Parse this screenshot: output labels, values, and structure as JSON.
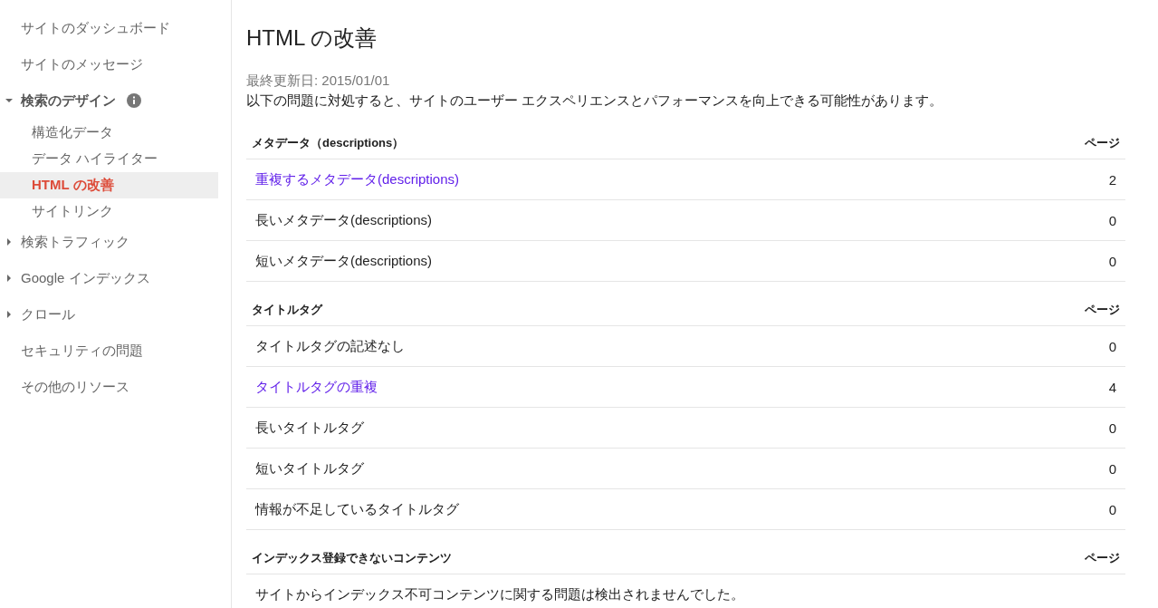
{
  "sidebar": {
    "items": [
      {
        "label": "サイトのダッシュボード",
        "kind": "link",
        "selected": false
      },
      {
        "label": "サイトのメッセージ",
        "kind": "link",
        "selected": false
      },
      {
        "label": "検索のデザイン",
        "kind": "group",
        "expanded": true,
        "info_icon": true,
        "selected": false,
        "children": [
          {
            "label": "構造化データ",
            "selected": false
          },
          {
            "label": "データ ハイライター",
            "selected": false
          },
          {
            "label": "HTML の改善",
            "selected": true
          },
          {
            "label": "サイトリンク",
            "selected": false
          }
        ]
      },
      {
        "label": "検索トラフィック",
        "kind": "group",
        "expanded": false,
        "selected": false
      },
      {
        "label": "Google インデックス",
        "kind": "group",
        "expanded": false,
        "selected": false
      },
      {
        "label": "クロール",
        "kind": "group",
        "expanded": false,
        "selected": false
      },
      {
        "label": "セキュリティの問題",
        "kind": "link",
        "selected": false
      },
      {
        "label": "その他のリソース",
        "kind": "link",
        "selected": false
      }
    ]
  },
  "page": {
    "title": "HTML の改善",
    "updated": "最終更新日: 2015/01/01",
    "description": "以下の問題に対処すると、サイトのユーザー エクスペリエンスとパフォーマンスを向上できる可能性があります。"
  },
  "sections": [
    {
      "title": "メタデータ（descriptions）",
      "column": "ページ",
      "rows": [
        {
          "label": "重複するメタデータ(descriptions)",
          "count": "2",
          "link": true
        },
        {
          "label": "長いメタデータ(descriptions)",
          "count": "0",
          "link": false
        },
        {
          "label": "短いメタデータ(descriptions)",
          "count": "0",
          "link": false
        }
      ]
    },
    {
      "title": "タイトルタグ",
      "column": "ページ",
      "rows": [
        {
          "label": "タイトルタグの記述なし",
          "count": "0",
          "link": false
        },
        {
          "label": "タイトルタグの重複",
          "count": "4",
          "link": true
        },
        {
          "label": "長いタイトルタグ",
          "count": "0",
          "link": false
        },
        {
          "label": "短いタイトルタグ",
          "count": "0",
          "link": false
        },
        {
          "label": "情報が不足しているタイトルタグ",
          "count": "0",
          "link": false
        }
      ]
    },
    {
      "title": "インデックス登録できないコンテンツ",
      "column": "ページ",
      "message": "サイトからインデックス不可コンテンツに関する問題は検出されませんでした。"
    }
  ]
}
